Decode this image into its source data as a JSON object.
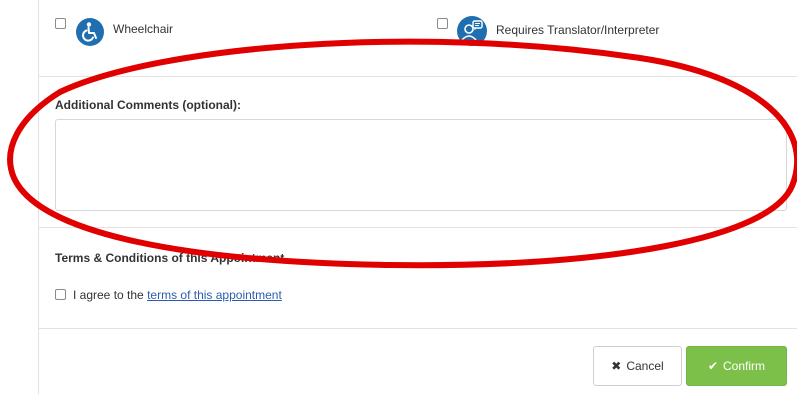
{
  "accessibility_options": [
    {
      "label": "Wheelchair",
      "icon": "wheelchair-icon",
      "checked": false
    },
    {
      "label": "Requires Translator/Interpreter",
      "icon": "interpreter-icon",
      "checked": false
    }
  ],
  "comments": {
    "label": "Additional Comments (optional):",
    "value": ""
  },
  "terms": {
    "heading": "Terms & Conditions of this Appointment",
    "agree_prefix": "I agree to the",
    "agree_link": "terms of this appointment",
    "checked": false
  },
  "actions": {
    "cancel_label": "Cancel",
    "confirm_label": "Confirm"
  },
  "colors": {
    "icon_blue": "#1f6fb0",
    "confirm_green": "#7cc04a",
    "link_blue": "#2a5db0",
    "annotation_red": "#e00000"
  }
}
